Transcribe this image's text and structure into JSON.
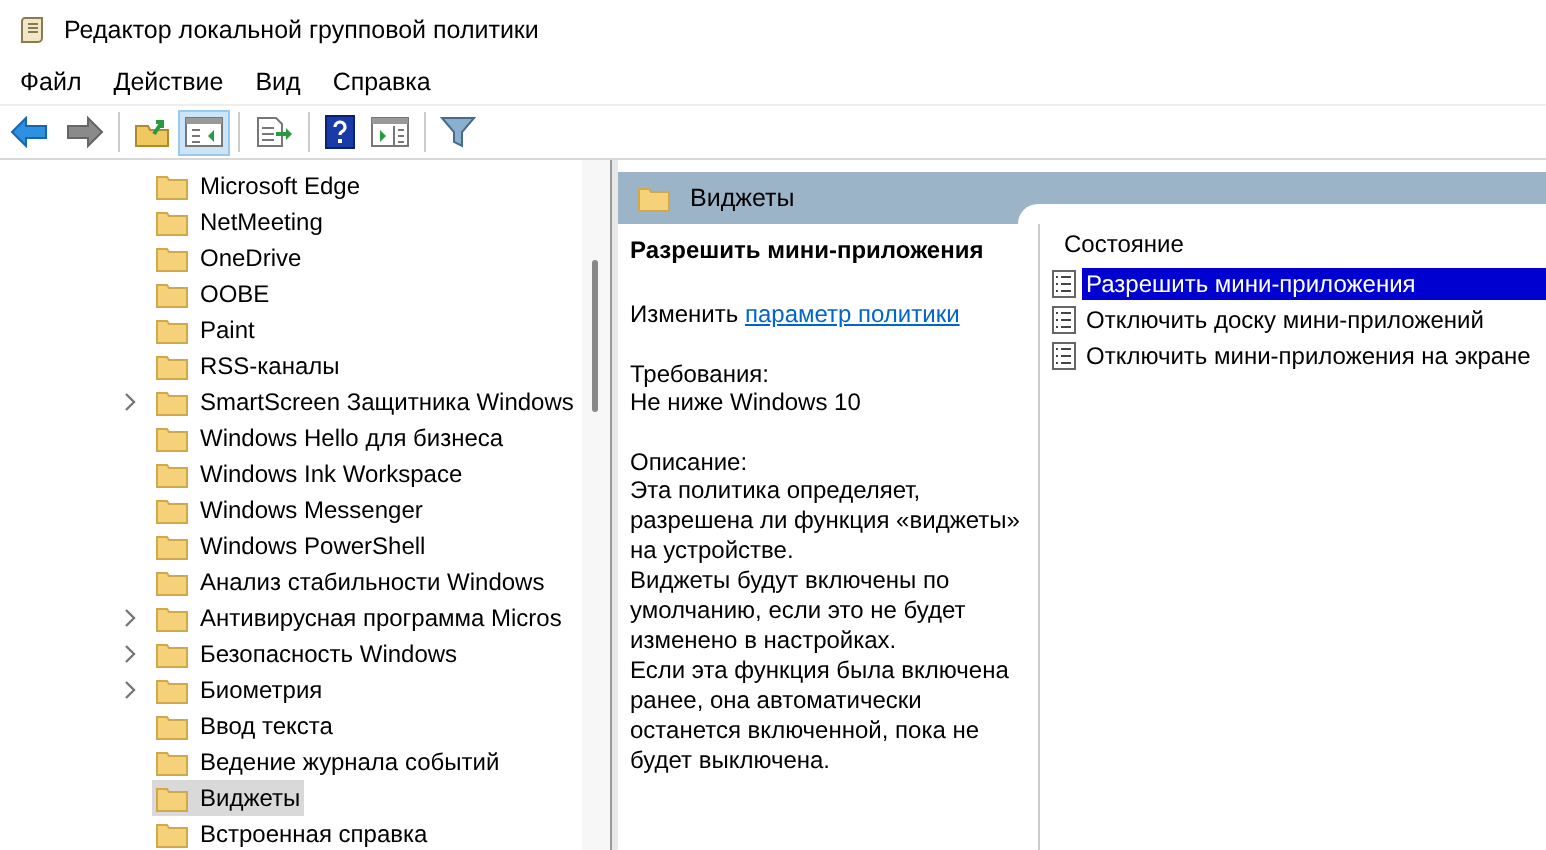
{
  "window": {
    "title": "Редактор локальной групповой политики"
  },
  "menu": [
    "Файл",
    "Действие",
    "Вид",
    "Справка"
  ],
  "toolbar": [
    {
      "kind": "back",
      "pressed": false
    },
    {
      "kind": "forward",
      "pressed": false
    },
    {
      "kind": "sep"
    },
    {
      "kind": "up",
      "pressed": false
    },
    {
      "kind": "tree",
      "pressed": true
    },
    {
      "kind": "sep"
    },
    {
      "kind": "export",
      "pressed": false
    },
    {
      "kind": "sep"
    },
    {
      "kind": "help",
      "pressed": false
    },
    {
      "kind": "pane",
      "pressed": false
    },
    {
      "kind": "sep"
    },
    {
      "kind": "filter",
      "pressed": false
    }
  ],
  "tree": [
    {
      "label": "Microsoft Edge",
      "expandable": false,
      "selected": false
    },
    {
      "label": "NetMeeting",
      "expandable": false,
      "selected": false
    },
    {
      "label": "OneDrive",
      "expandable": false,
      "selected": false
    },
    {
      "label": "OOBE",
      "expandable": false,
      "selected": false
    },
    {
      "label": "Paint",
      "expandable": false,
      "selected": false
    },
    {
      "label": "RSS-каналы",
      "expandable": false,
      "selected": false
    },
    {
      "label": "SmartScreen Защитника Windows",
      "expandable": true,
      "selected": false
    },
    {
      "label": "Windows Hello для бизнеса",
      "expandable": false,
      "selected": false
    },
    {
      "label": "Windows Ink Workspace",
      "expandable": false,
      "selected": false
    },
    {
      "label": "Windows Messenger",
      "expandable": false,
      "selected": false
    },
    {
      "label": "Windows PowerShell",
      "expandable": false,
      "selected": false
    },
    {
      "label": "Анализ стабильности Windows",
      "expandable": false,
      "selected": false
    },
    {
      "label": "Антивирусная программа Micros",
      "expandable": true,
      "selected": false
    },
    {
      "label": "Безопасность Windows",
      "expandable": true,
      "selected": false
    },
    {
      "label": "Биометрия",
      "expandable": true,
      "selected": false
    },
    {
      "label": "Ввод текста",
      "expandable": false,
      "selected": false
    },
    {
      "label": "Ведение журнала событий",
      "expandable": false,
      "selected": false
    },
    {
      "label": "Виджеты",
      "expandable": false,
      "selected": true
    },
    {
      "label": "Встроенная справка",
      "expandable": false,
      "selected": false
    }
  ],
  "details": {
    "header": "Виджеты",
    "policy_title": "Разрешить мини-приложения",
    "edit_prefix": "Изменить",
    "edit_link": "параметр политики",
    "requirements_label": "Требования:",
    "requirements": "Не ниже Windows 10",
    "description_label": "Описание:",
    "description": [
      "Эта политика определяет,\nразрешена ли функция «виджеты»\nна устройстве.",
      "Виджеты будут включены по\nумолчанию, если это не будет\nизменено в настройках.",
      "Если эта функция была включена\nранее, она автоматически\nостанется включенной, пока не\nбудет выключена."
    ]
  },
  "list": {
    "column": "Состояние",
    "items": [
      {
        "label": "Разрешить мини-приложения",
        "selected": true
      },
      {
        "label": "Отключить доску мини-приложений",
        "selected": false
      },
      {
        "label": "Отключить мини-приложения на экране",
        "selected": false
      }
    ]
  }
}
